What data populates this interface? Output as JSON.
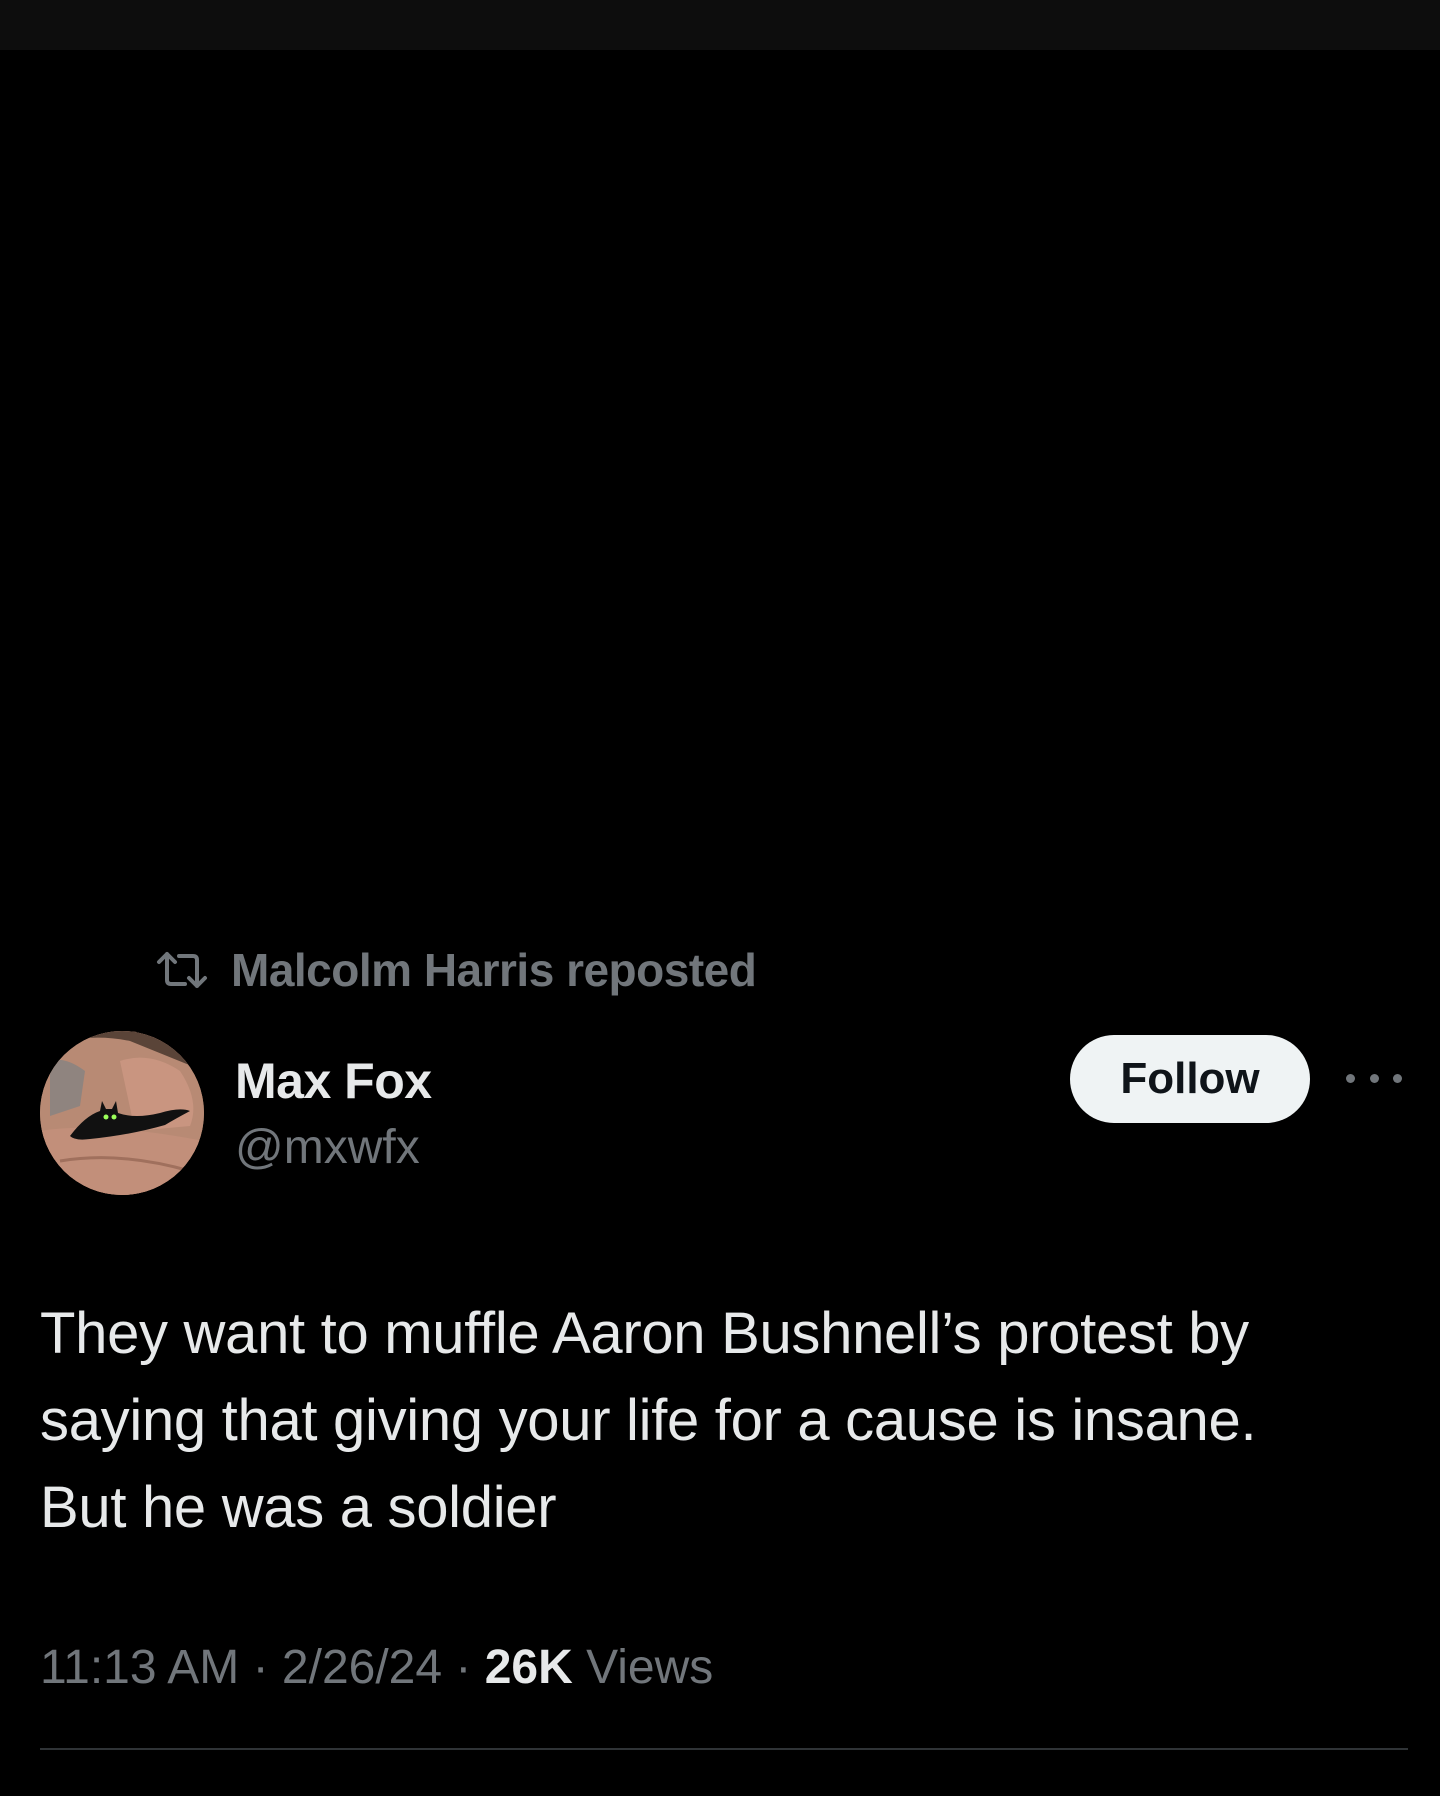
{
  "repost": {
    "icon": "repost-icon",
    "text": "Malcolm Harris reposted"
  },
  "author": {
    "avatar_icon": "cat-avatar",
    "display_name": "Max Fox",
    "handle": "@mxwfx"
  },
  "actions": {
    "follow_label": "Follow",
    "more_icon": "more-options-icon"
  },
  "tweet": {
    "lines": [
      "They want to muffle Aaron Bushnell’s protest by",
      "saying that giving your life for a cause is insane.",
      "But he was a soldier"
    ]
  },
  "meta": {
    "time": "11:13 AM",
    "sep1": " · ",
    "date": "2/26/24",
    "sep2": " · ",
    "views_count": "26K",
    "views_label": " Views"
  },
  "colors": {
    "background": "#000000",
    "primary_text": "#e7e9ea",
    "secondary_text": "#71767b",
    "follow_bg": "#eff3f4",
    "follow_text": "#0f1419",
    "divider": "#2f3336"
  }
}
